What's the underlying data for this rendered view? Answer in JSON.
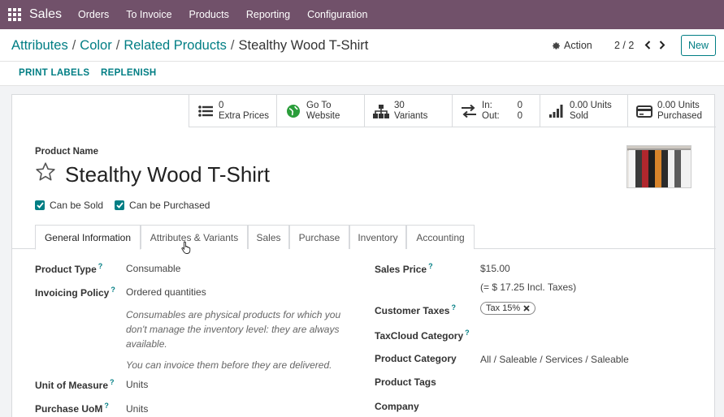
{
  "topbar": {
    "app_name": "Sales",
    "menu": [
      "Orders",
      "To Invoice",
      "Products",
      "Reporting",
      "Configuration"
    ]
  },
  "breadcrumb": {
    "items": [
      "Attributes",
      "Color",
      "Related Products"
    ],
    "current": "Stealthy Wood T-Shirt"
  },
  "control": {
    "action_label": "Action",
    "pager": "2 / 2",
    "new_label": "New"
  },
  "statusbar": {
    "buttons": [
      "PRINT LABELS",
      "REPLENISH"
    ]
  },
  "smart_buttons": {
    "extra_prices": {
      "value": "0",
      "label": "Extra Prices"
    },
    "website": {
      "line1": "Go To",
      "line2": "Website"
    },
    "variants": {
      "value": "30",
      "label": "Variants"
    },
    "inout": {
      "in_label": "In:",
      "in_value": "0",
      "out_label": "Out:",
      "out_value": "0"
    },
    "sold": {
      "value": "0.00 Units",
      "label": "Sold"
    },
    "purchased": {
      "value": "0.00 Units",
      "label": "Purchased"
    }
  },
  "product": {
    "name_label": "Product Name",
    "name": "Stealthy Wood T-Shirt",
    "can_be_sold": "Can be Sold",
    "can_be_purchased": "Can be Purchased"
  },
  "tabs": [
    "General Information",
    "Attributes & Variants",
    "Sales",
    "Purchase",
    "Inventory",
    "Accounting"
  ],
  "left_fields": {
    "product_type": {
      "label": "Product Type",
      "value": "Consumable"
    },
    "invoicing_policy": {
      "label": "Invoicing Policy",
      "value": "Ordered quantities"
    },
    "note1": "Consumables are physical products for which you don't manage the inventory level: they are always available.",
    "note2": "You can invoice them before they are delivered.",
    "uom": {
      "label": "Unit of Measure",
      "value": "Units"
    },
    "purchase_uom": {
      "label": "Purchase UoM",
      "value": "Units"
    }
  },
  "right_fields": {
    "sales_price": {
      "label": "Sales Price",
      "value": "$15.00",
      "incl": "(= $ 17.25 Incl. Taxes)"
    },
    "customer_taxes": {
      "label": "Customer Taxes",
      "tag": "Tax 15%"
    },
    "taxcloud": {
      "label": "TaxCloud Category"
    },
    "category": {
      "label": "Product Category",
      "value": "All / Saleable / Services / Saleable"
    },
    "tags": {
      "label": "Product Tags"
    },
    "company": {
      "label": "Company"
    }
  },
  "colors": {
    "navbar": "#71516a",
    "accent": "#017e84"
  },
  "icons": {
    "apps": "apps-grid-icon",
    "gear": "gear-icon",
    "prev": "chevron-left-icon",
    "next": "chevron-right-icon",
    "list": "list-icon",
    "globe": "globe-icon",
    "sitemap": "sitemap-icon",
    "exchange": "exchange-icon",
    "chart": "bar-chart-icon",
    "card": "credit-card-icon",
    "star": "star-icon"
  }
}
